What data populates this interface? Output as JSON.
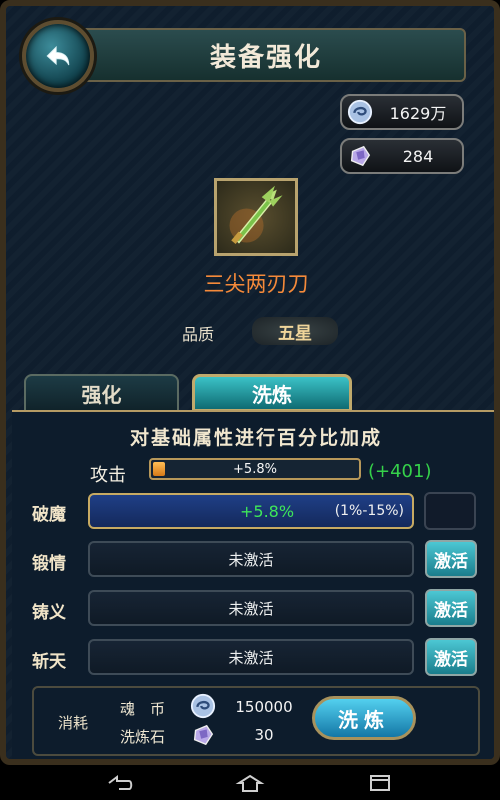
{
  "header": {
    "title": "装备强化"
  },
  "currency": {
    "soul_coin": "1629万",
    "stone": "284"
  },
  "item": {
    "name": "三尖两刃刀",
    "quality_label": "品质",
    "quality_value": "五星"
  },
  "tabs": [
    {
      "label": "强化",
      "active": false
    },
    {
      "label": "洗炼",
      "active": true
    }
  ],
  "description": "对基础属性进行百分比加成",
  "attack": {
    "label": "攻击",
    "value_text": "+5.8%",
    "fill": 0.058,
    "bonus": "(+401)"
  },
  "rows": [
    {
      "label": "破魔",
      "active": true,
      "value": "+5.8%",
      "range": "(1%-15%)"
    },
    {
      "label": "锻情",
      "active": false,
      "status": "未激活",
      "button": "激活"
    },
    {
      "label": "铸义",
      "active": false,
      "status": "未激活",
      "button": "激活"
    },
    {
      "label": "斩天",
      "active": false,
      "status": "未激活",
      "button": "激活"
    }
  ],
  "cost": {
    "label": "消耗",
    "items": [
      {
        "name": "魂　币",
        "value": "150000",
        "icon": "soul-coin-icon"
      },
      {
        "name": "洗炼石",
        "value": "30",
        "icon": "refine-stone-icon"
      }
    ]
  },
  "wash_button": "洗炼",
  "colors": {
    "accent_teal": "#1f8d98",
    "gold_border": "#b59b64",
    "bonus_green": "#35d14a",
    "item_name_orange": "#f58a3a"
  }
}
